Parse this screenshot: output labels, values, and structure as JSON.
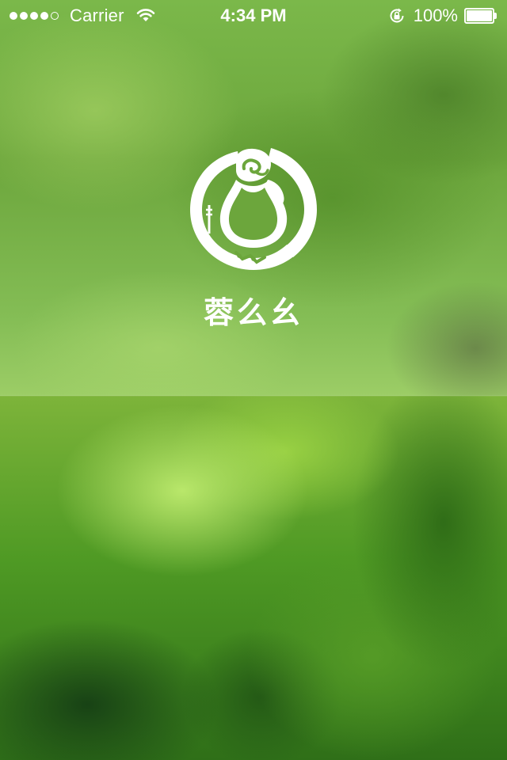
{
  "status_bar": {
    "signal_filled": 4,
    "signal_total": 5,
    "carrier": "Carrier",
    "wifi_icon": "wifi-icon",
    "time": "4:34 PM",
    "orientation_lock_icon": "orientation-lock-icon",
    "battery_percent": "100%",
    "battery_level": 1.0
  },
  "splash": {
    "logo_icon": "gourd-logo-icon",
    "brand_name": "蓉么幺"
  },
  "colors": {
    "foreground": "#ffffff",
    "background_green": "#6ca63c"
  }
}
